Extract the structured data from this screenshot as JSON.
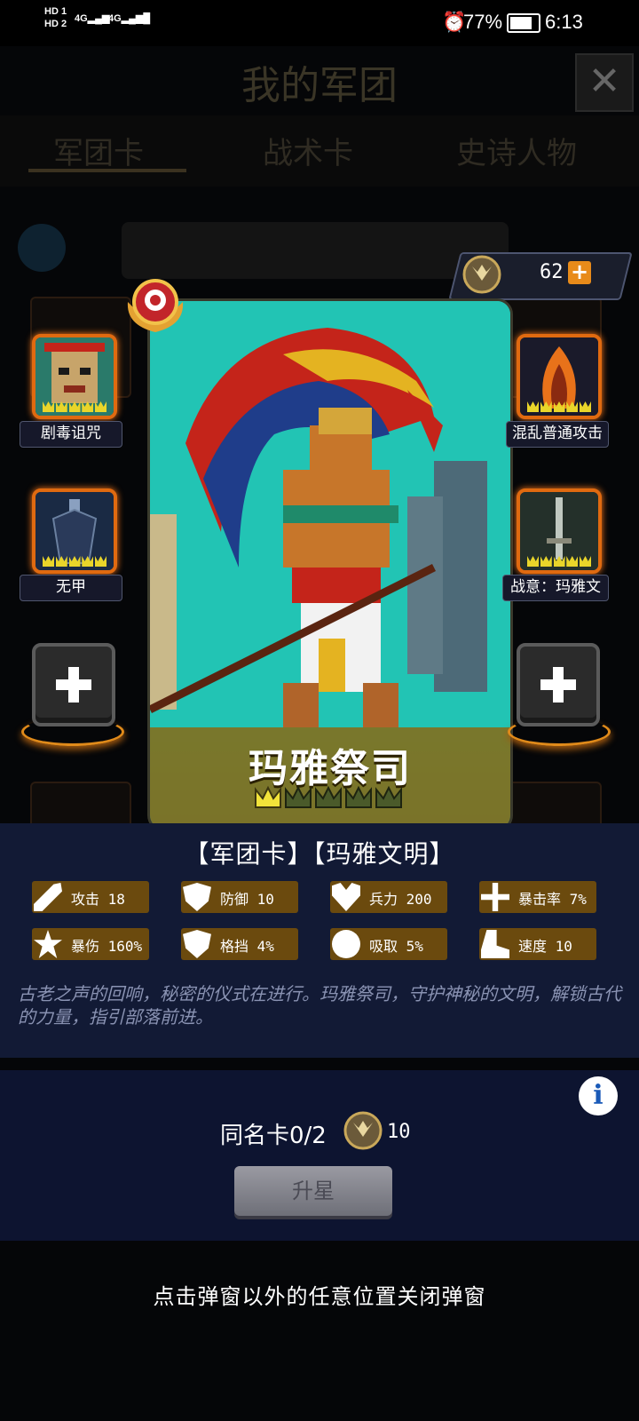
{
  "status_bar": {
    "sim1": "HD 1",
    "sim2": "HD 2",
    "net": "4G",
    "battery": "77%",
    "time": "6:13"
  },
  "background": {
    "title": "我的军团",
    "tabs": [
      "军团卡",
      "战术卡",
      "史诗人物"
    ]
  },
  "currency": {
    "count": "62"
  },
  "card": {
    "name": "玛雅祭司",
    "stars": 1,
    "max_stars": 5
  },
  "skills": {
    "left": [
      {
        "label": "剧毒诅咒"
      },
      {
        "label": "无甲"
      }
    ],
    "right": [
      {
        "label": "混乱普通攻击"
      },
      {
        "label": "战意：玛雅文"
      }
    ]
  },
  "info": {
    "title": "【军团卡】【玛雅文明】",
    "stats": [
      {
        "icon": "sword-icon",
        "text": "攻击 18"
      },
      {
        "icon": "shield-icon",
        "text": "防御 10"
      },
      {
        "icon": "heart-icon",
        "text": "兵力 200"
      },
      {
        "icon": "crosshair-icon",
        "text": "暴击率 7%"
      },
      {
        "icon": "burst-icon",
        "text": "暴伤 160%"
      },
      {
        "icon": "parry-icon",
        "text": "格挡 4%"
      },
      {
        "icon": "drain-icon",
        "text": "吸取 5%"
      },
      {
        "icon": "boot-icon",
        "text": "速度 10"
      }
    ],
    "description": "古老之声的回响，秘密的仪式在进行。玛雅祭司，守护神秘的文明，解锁古代的力量，指引部落前进。"
  },
  "upgrade": {
    "same_card": "同名卡0/2",
    "cost": "10",
    "button": "升星"
  },
  "close_hint": "点击弹窗以外的任意位置关闭弹窗",
  "colors": {
    "accent_orange": "#e06a10",
    "stat_bg": "#6b4a0e",
    "panel_bg": "#121a35",
    "card_bg": "#20c0b0",
    "crown_gold": "#e9d52a"
  }
}
